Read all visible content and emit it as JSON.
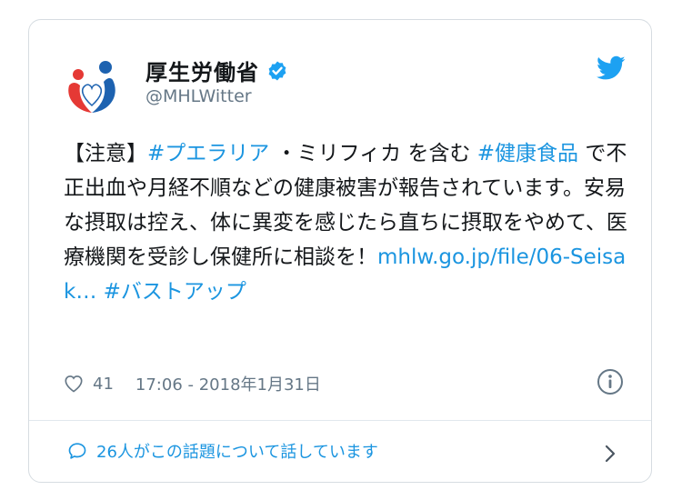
{
  "account": {
    "name": "厚生労働省",
    "handle": "@MHLWitter"
  },
  "tweet": {
    "t1": "【注意】",
    "tag1": "#プエラリア",
    "t2": " ・ミリフィカ を含む ",
    "tag2": "#健康食品",
    "t3": " で不正出血や月経不順などの健康被害が報告されています。安易な摂取は控え、体に異変を感じたら直ちに摂取をやめて、医療機関を受診し保健所に相談を！",
    "url": "mhlw.go.jp/file/06-Seisak…",
    "t4": " ",
    "tag3": "#バストアップ"
  },
  "meta": {
    "likes": "41",
    "timestamp": "17:06 - 2018年1月31日"
  },
  "footer": {
    "talking": "26人がこの話題について話しています"
  },
  "colors": {
    "link": "#1b95e0",
    "muted": "#657786",
    "verified": "#1da1f2",
    "logo_blue": "#1d62b0",
    "logo_red": "#e53935"
  },
  "icons": [
    "verified-badge-icon",
    "twitter-bird-icon",
    "heart-icon",
    "info-icon",
    "speech-bubble-icon",
    "chevron-right-icon"
  ]
}
